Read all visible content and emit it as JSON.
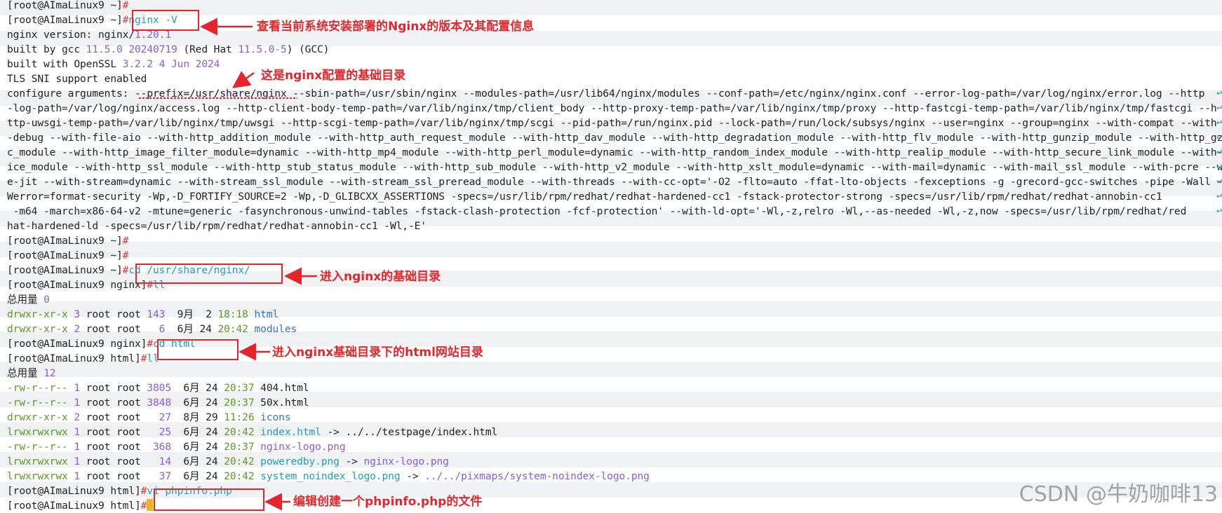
{
  "terminal": {
    "prompt_home": "[root@AImaLinux9 ~]",
    "prompt_nginx": "[root@AImaLinux9 nginx]",
    "prompt_html": "[root@AImaLinux9 html]",
    "hash": "#",
    "cmd_nginx_v": "nginx -V",
    "nginx_version_label": "nginx version: nginx/",
    "nginx_version_value": "1.20.1",
    "built_by_gcc": "built by gcc ",
    "gcc_version": "11.5.0 20240719",
    "gcc_rest_a": " (Red Hat ",
    "gcc_rh_version": "11.5.0-5",
    "gcc_rest_b": ") (GCC)",
    "built_openssl": "built with OpenSSL ",
    "openssl_version": "3.2.2 4 Jun 2024",
    "tls_sni": "TLS SNI support enabled",
    "configure_args": [
      "configure arguments: --prefix=/usr/share/nginx --sbin-path=/usr/sbin/nginx --modules-path=/usr/lib64/nginx/modules --conf-path=/etc/nginx/nginx.conf --error-log-path=/var/log/nginx/error.log --http",
      "-log-path=/var/log/nginx/access.log --http-client-body-temp-path=/var/lib/nginx/tmp/client_body --http-proxy-temp-path=/var/lib/nginx/tmp/proxy --http-fastcgi-temp-path=/var/lib/nginx/tmp/fastcgi --h",
      "ttp-uwsgi-temp-path=/var/lib/nginx/tmp/uwsgi --http-scgi-temp-path=/var/lib/nginx/tmp/scgi --pid-path=/run/nginx.pid --lock-path=/run/lock/subsys/nginx --user=nginx --group=nginx --with-compat --with",
      "-debug --with-file-aio --with-http_addition_module --with-http_auth_request_module --with-http_dav_module --with-http_degradation_module --with-http_flv_module --with-http_gunzip_module --with-http_gzip_stati",
      "c_module --with-http_image_filter_module=dynamic --with-http_mp4_module --with-http_perl_module=dynamic --with-http_random_index_module --with-http_realip_module --with-http_secure_link_module --with-http_sl",
      "ice_module --with-http_ssl_module --with-http_stub_status_module --with-http_sub_module --with-http_v2_module --with-http_xslt_module=dynamic --with-mail=dynamic --with-mail_ssl_module --with-pcre --with-pcr",
      "e-jit --with-stream=dynamic --with-stream_ssl_module --with-stream_ssl_preread_module --with-threads --with-cc-opt='-O2 -flto=auto -ffat-lto-objects -fexceptions -g -grecord-gcc-switches -pipe -Wall -",
      "Werror=format-security -Wp,-D_FORTIFY_SOURCE=2 -Wp,-D_GLIBCXX_ASSERTIONS -specs=/usr/lib/rpm/redhat/redhat-hardened-cc1 -fstack-protector-strong -specs=/usr/lib/rpm/redhat/redhat-annobin-cc1",
      " -m64 -march=x86-64-v2 -mtune=generic -fasynchronous-unwind-tables -fstack-clash-protection -fcf-protection' --with-ld-opt='-Wl,-z,relro -Wl,--as-needed -Wl,-z,now -specs=/usr/lib/rpm/redhat/red",
      "hat-hardened-ld -specs=/usr/lib/rpm/redhat/redhat-annobin-cc1 -Wl,-E'"
    ],
    "cmd_cd_nginx": "cd /usr/share/nginx/",
    "cmd_ll": "ll",
    "total_label": "总用量 ",
    "total_nginx": "0",
    "nginx_listing": [
      {
        "perm": "drwxr-xr-x",
        "links": "3",
        "owner": " root root ",
        "size": "143",
        "date": "  9月  2 ",
        "time": "18:18",
        "name": "html",
        "target": ""
      },
      {
        "perm": "drwxr-xr-x",
        "links": "2",
        "owner": " root root ",
        "size": "  6",
        "date": "  6月 24 ",
        "time": "20:42",
        "name": "modules",
        "target": ""
      }
    ],
    "cmd_cd_html": "cd html",
    "total_html": "12",
    "html_listing": [
      {
        "perm": "-rw-r--r--",
        "links": "1",
        "owner": " root root ",
        "size": "3805",
        "date": "  6月 24 ",
        "time": "20:37",
        "name": "404.html",
        "target": ""
      },
      {
        "perm": "-rw-r--r--",
        "links": "1",
        "owner": " root root ",
        "size": "3848",
        "date": "  6月 24 ",
        "time": "20:37",
        "name": "50x.html",
        "target": ""
      },
      {
        "perm": "drwxr-xr-x",
        "links": "2",
        "owner": " root root ",
        "size": "  27",
        "date": "  8月 29 ",
        "time": "11:26",
        "name": "icons",
        "target": ""
      },
      {
        "perm": "lrwxrwxrwx",
        "links": "1",
        "owner": " root root ",
        "size": "  25",
        "date": "  6月 24 ",
        "time": "20:42",
        "name": "index.html",
        "target": "../../testpage/index.html"
      },
      {
        "perm": "-rw-r--r--",
        "links": "1",
        "owner": " root root ",
        "size": " 368",
        "date": "  6月 24 ",
        "time": "20:37",
        "name": "nginx-logo.png",
        "target": ""
      },
      {
        "perm": "lrwxrwxrwx",
        "links": "1",
        "owner": " root root ",
        "size": "  14",
        "date": "  6月 24 ",
        "time": "20:42",
        "name": "poweredby.png",
        "target": "nginx-logo.png"
      },
      {
        "perm": "lrwxrwxrwx",
        "links": "1",
        "owner": " root root ",
        "size": "  37",
        "date": "  6月 24 ",
        "time": "20:42",
        "name": "system_noindex_logo.png",
        "target": "../../pixmaps/system-noindex-logo.png"
      }
    ],
    "link_arrow": " -> ",
    "cmd_vi": "vi phpinfo.php",
    "wrap_mark": "↩"
  },
  "annotations": {
    "nginx_v": "查看当前系统安装部署的Nginx的版本及其配置信息",
    "prefix": "这是nginx配置的基础目录",
    "cd_nginx": "进入nginx的基础目录",
    "cd_html": "进入nginx基础目录下的html网站目录",
    "vi": "编辑创建一个phpinfo.php的文件"
  },
  "watermark": "CSDN @牛奶咖啡13",
  "colors": {
    "prompt_hash": "#e03c3c",
    "command": "#1f9fb8",
    "number": "#8a5cd6",
    "directory": "#3a6fc4",
    "date_time": "#5d9a25",
    "option": "#e0841f",
    "annotation": "#e4262c",
    "band": "#f0f1f2"
  }
}
